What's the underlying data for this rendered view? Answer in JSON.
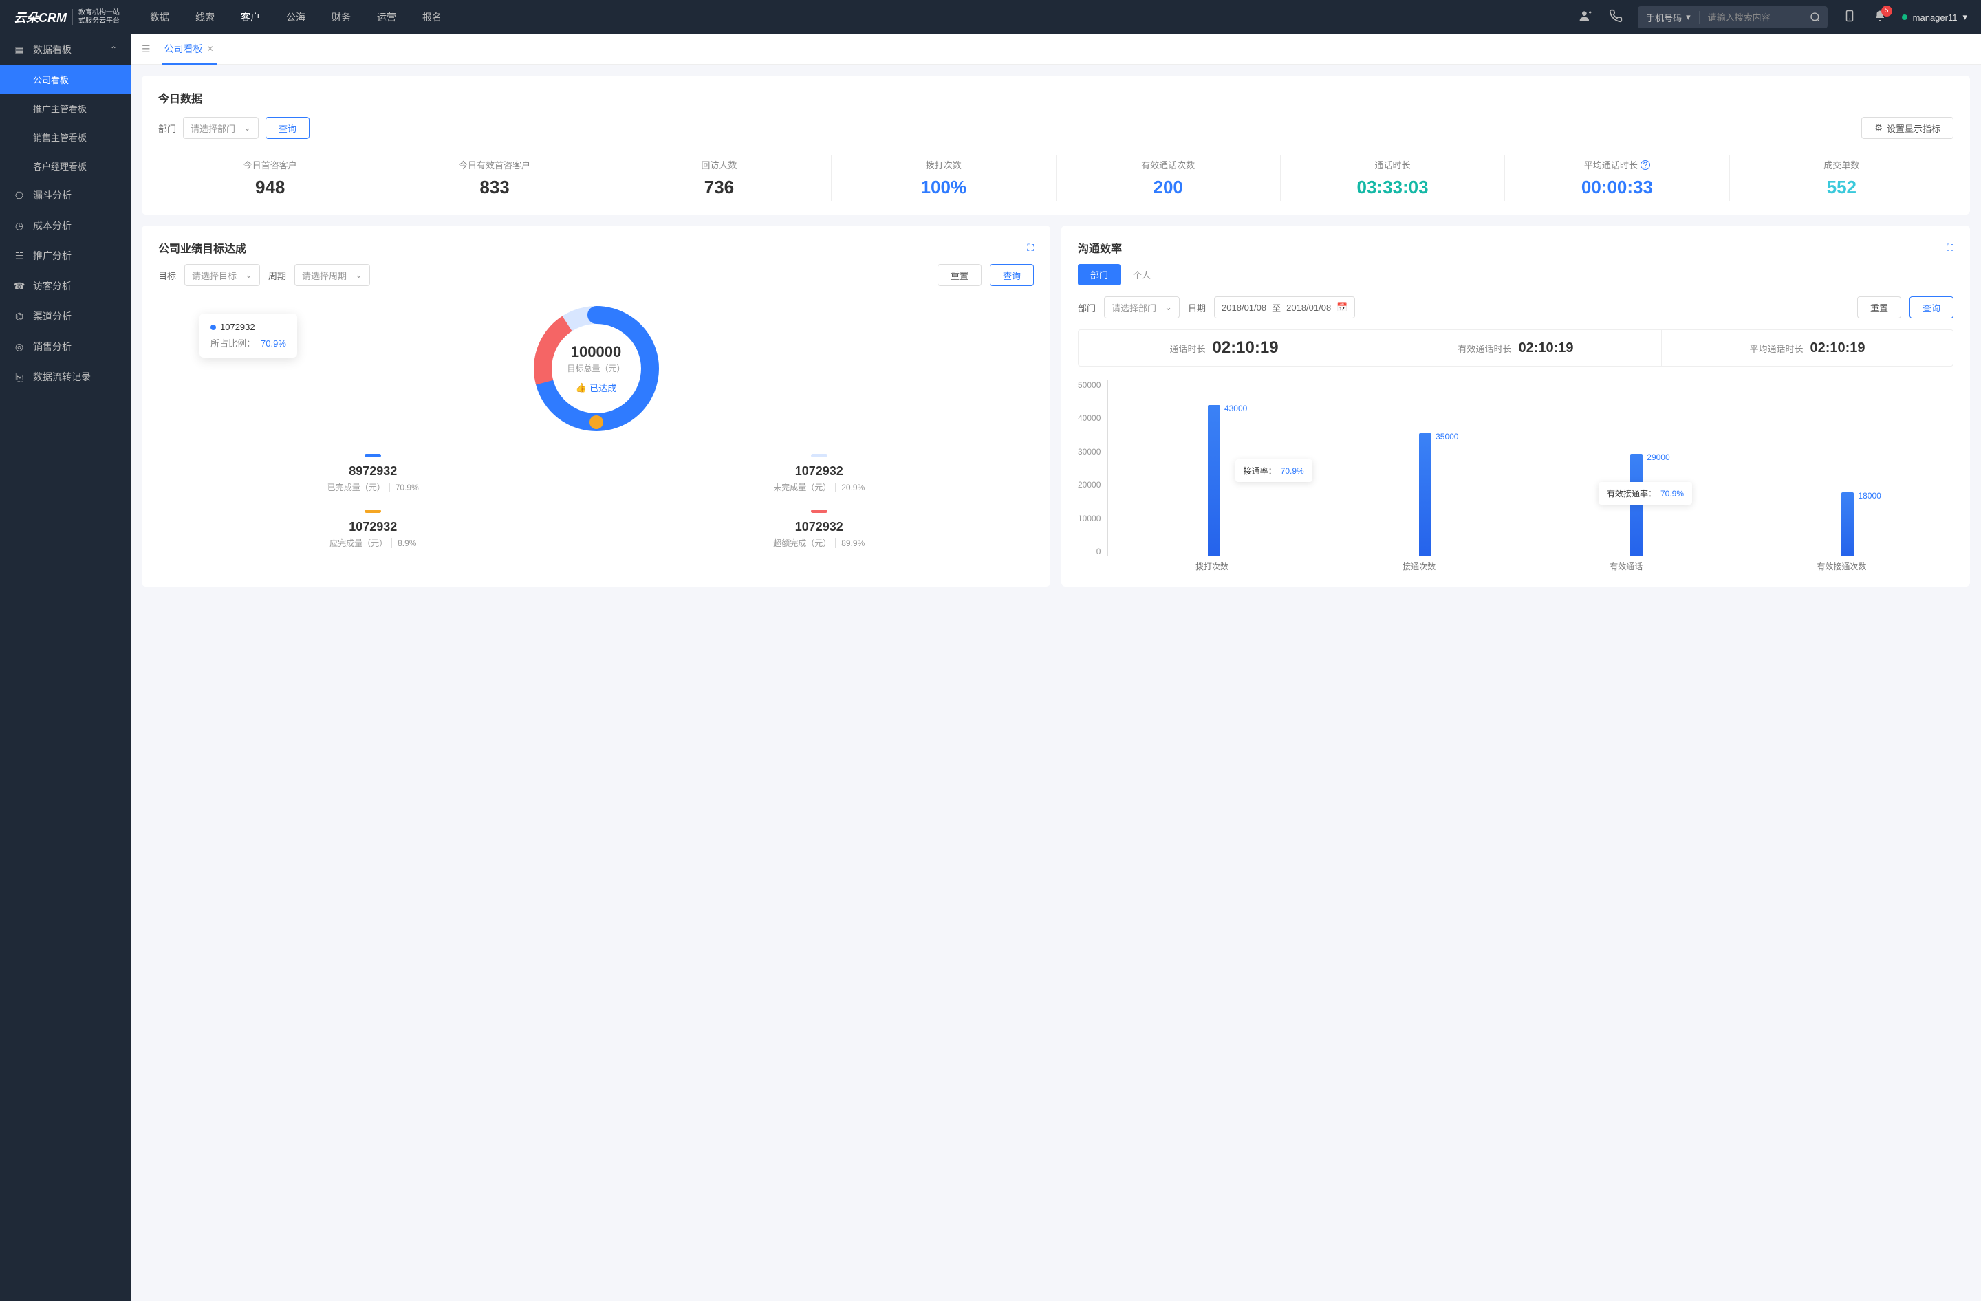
{
  "header": {
    "logo": "云朵CRM",
    "logo_sub": "教育机构一站\n式服务云平台",
    "nav": [
      "数据",
      "线索",
      "客户",
      "公海",
      "财务",
      "运营",
      "报名"
    ],
    "nav_active": 2,
    "search_type": "手机号码",
    "search_placeholder": "请输入搜索内容",
    "badge": "5",
    "user": "manager11"
  },
  "sidebar": {
    "group": "数据看板",
    "items": [
      "公司看板",
      "推广主管看板",
      "销售主管看板",
      "客户经理看板"
    ],
    "active": 0,
    "singles": [
      "漏斗分析",
      "成本分析",
      "推广分析",
      "访客分析",
      "渠道分析",
      "销售分析",
      "数据流转记录"
    ]
  },
  "tab": {
    "label": "公司看板"
  },
  "today": {
    "title": "今日数据",
    "dept_label": "部门",
    "dept_placeholder": "请选择部门",
    "query": "查询",
    "indicator_btn": "设置显示指标",
    "kpis": [
      {
        "label": "今日首咨客户",
        "value": "948",
        "color": ""
      },
      {
        "label": "今日有效首咨客户",
        "value": "833",
        "color": ""
      },
      {
        "label": "回访人数",
        "value": "736",
        "color": ""
      },
      {
        "label": "拨打次数",
        "value": "100%",
        "color": "c-blue"
      },
      {
        "label": "有效通话次数",
        "value": "200",
        "color": "c-blue"
      },
      {
        "label": "通话时长",
        "value": "03:33:03",
        "color": "c-teal"
      },
      {
        "label": "平均通话时长",
        "value": "00:00:33",
        "color": "c-blue",
        "info": true
      },
      {
        "label": "成交单数",
        "value": "552",
        "color": "c-cyan"
      }
    ]
  },
  "target": {
    "title": "公司业绩目标达成",
    "goal_label": "目标",
    "goal_placeholder": "请选择目标",
    "period_label": "周期",
    "period_placeholder": "请选择周期",
    "reset": "重置",
    "query": "查询",
    "tooltip_value": "1072932",
    "tooltip_pct_label": "所占比例：",
    "tooltip_pct": "70.9%",
    "center_value": "100000",
    "center_label": "目标总量（元）",
    "status": "已达成",
    "legend": [
      {
        "color": "#2f7bff",
        "value": "8972932",
        "label": "已完成量（元）",
        "pct": "70.9%"
      },
      {
        "color": "#d8e6ff",
        "value": "1072932",
        "label": "未完成量（元）",
        "pct": "20.9%"
      },
      {
        "color": "#f5a623",
        "value": "1072932",
        "label": "应完成量（元）",
        "pct": "8.9%"
      },
      {
        "color": "#f56565",
        "value": "1072932",
        "label": "超额完成（元）",
        "pct": "89.9%"
      }
    ]
  },
  "efficiency": {
    "title": "沟通效率",
    "tab1": "部门",
    "tab2": "个人",
    "dept_label": "部门",
    "dept_placeholder": "请选择部门",
    "date_label": "日期",
    "date_from": "2018/01/08",
    "date_to": "2018/01/08",
    "date_sep": "至",
    "reset": "重置",
    "query": "查询",
    "stats": [
      {
        "label": "通话时长",
        "value": "02:10:19"
      },
      {
        "label": "有效通话时长",
        "value": "02:10:19"
      },
      {
        "label": "平均通话时长",
        "value": "02:10:19"
      }
    ],
    "float1_label": "接通率：",
    "float1_pct": "70.9%",
    "float2_label": "有效接通率：",
    "float2_pct": "70.9%"
  },
  "chart_data": {
    "type": "bar",
    "categories": [
      "拨打次数",
      "接通次数",
      "有效通话",
      "有效接通次数"
    ],
    "values": [
      43000,
      35000,
      29000,
      18000
    ],
    "ylim": [
      0,
      50000
    ],
    "yticks": [
      0,
      10000,
      20000,
      30000,
      40000,
      50000
    ],
    "data_labels": [
      "43000",
      "35000",
      "29000",
      "18000"
    ]
  }
}
